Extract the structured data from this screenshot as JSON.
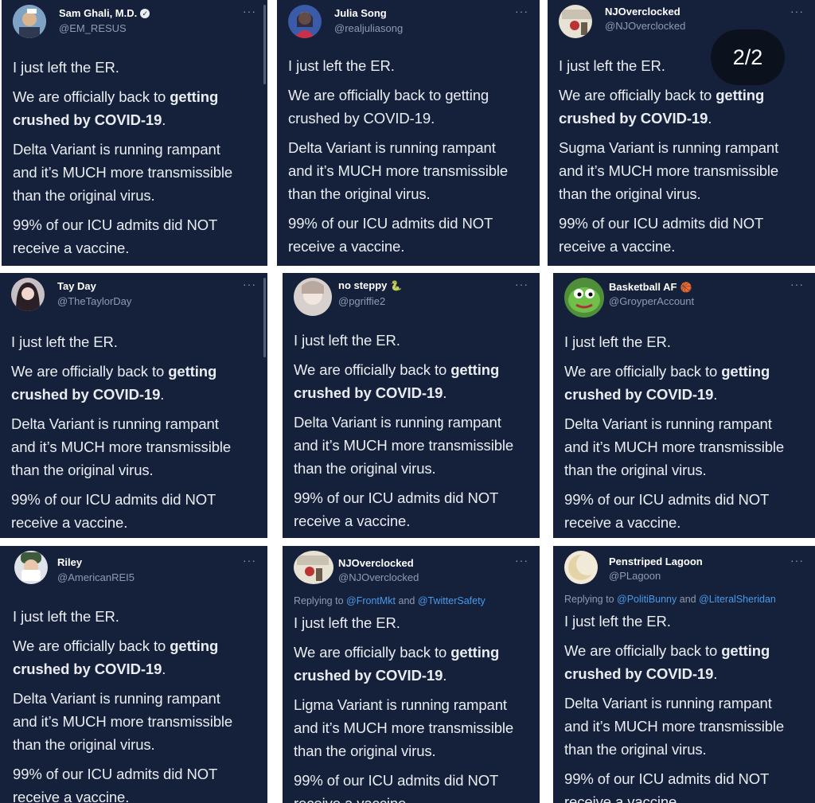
{
  "page_badge": "2/2",
  "tweets": [
    {
      "name": "Sam Ghali, M.D.",
      "handle": "@EM_RESUS",
      "verified": true,
      "replying": null,
      "variant_line_a": "Delta Variant is running rampant",
      "line_left": "I just left the ER."
    },
    {
      "name": "Julia Song",
      "handle": "@realjuliasong",
      "replying": null,
      "variant_line_a": "Delta Variant is running rampant"
    },
    {
      "name": "NJOverclocked",
      "handle": "@NJOverclocked",
      "replying": null,
      "variant_line_a": "Sugma Variant is running rampant"
    },
    {
      "name": "Tay Day",
      "handle": "@TheTaylorDay",
      "replying": null,
      "variant_line_a": "Delta Variant is running rampant"
    },
    {
      "name": "no steppy",
      "handle": "@pgriffie2",
      "emoji": "🐍",
      "replying": null,
      "variant_line_a": "Delta Variant is running rampant"
    },
    {
      "name": "Basketball AF",
      "handle": "@GroyperAccount",
      "emoji": "🏀",
      "replying": null,
      "variant_line_a": "Delta Variant is running rampant"
    },
    {
      "name": "Riley",
      "handle": "@AmericanREI5",
      "replying": null,
      "variant_line_a": "Delta Variant is running rampant"
    },
    {
      "name": "NJOverclocked",
      "handle": "@NJOverclocked",
      "replying": {
        "prefix": "Replying to",
        "m1": "@FrontMkt",
        "and": "and",
        "m2": "@TwitterSafety"
      },
      "variant_line_a": "Ligma Variant is running rampant"
    },
    {
      "name": "Penstriped Lagoon",
      "handle": "@PLagoon",
      "replying": {
        "prefix": "Replying to",
        "m1": "@PolitiBunny",
        "and": "and",
        "m2": "@LiteralSheridan"
      },
      "variant_line_a": "Delta Variant is running rampant"
    }
  ],
  "common": {
    "line1": "I just left the ER.",
    "line2_pre": "We are officially back to",
    "line2_bold1": "getting",
    "line2_bold2": "crushed by COVID-19",
    "line2_end": ".",
    "line3_b": "and it’s MUCH more transmissible",
    "line3_c": "than the original virus.",
    "line4_a": "99% of our ICU admits did NOT",
    "line4_b": "receive a vaccine.",
    "more": "···"
  },
  "colors": {
    "card_bg": "#15213b",
    "text": "#e9edf2",
    "muted": "#8e9bb0",
    "mention": "#4a99e9"
  }
}
